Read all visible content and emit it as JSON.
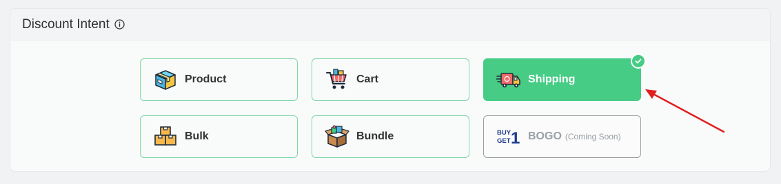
{
  "section": {
    "title": "Discount Intent",
    "info_icon": "info-circle-icon"
  },
  "options": [
    {
      "id": "product",
      "label": "Product",
      "icon": "product-box-icon",
      "selected": false,
      "disabled": false
    },
    {
      "id": "cart",
      "label": "Cart",
      "icon": "shopping-cart-icon",
      "selected": false,
      "disabled": false
    },
    {
      "id": "shipping",
      "label": "Shipping",
      "icon": "delivery-truck-icon",
      "selected": true,
      "disabled": false
    },
    {
      "id": "bulk",
      "label": "Bulk",
      "icon": "stacked-boxes-icon",
      "selected": false,
      "disabled": false
    },
    {
      "id": "bundle",
      "label": "Bundle",
      "icon": "gift-bundle-box-icon",
      "selected": false,
      "disabled": false
    },
    {
      "id": "bogo",
      "label": "BOGO",
      "sublabel": "(Coming Soon)",
      "icon_text": [
        "BUY",
        "GET",
        "1"
      ],
      "icon": "buy-get-one-icon",
      "selected": false,
      "disabled": true
    }
  ],
  "colors": {
    "accent": "#46cc85",
    "card_border": "#7dd8a6",
    "disabled_border": "#9a9ea3",
    "arrow": "#e02020"
  }
}
